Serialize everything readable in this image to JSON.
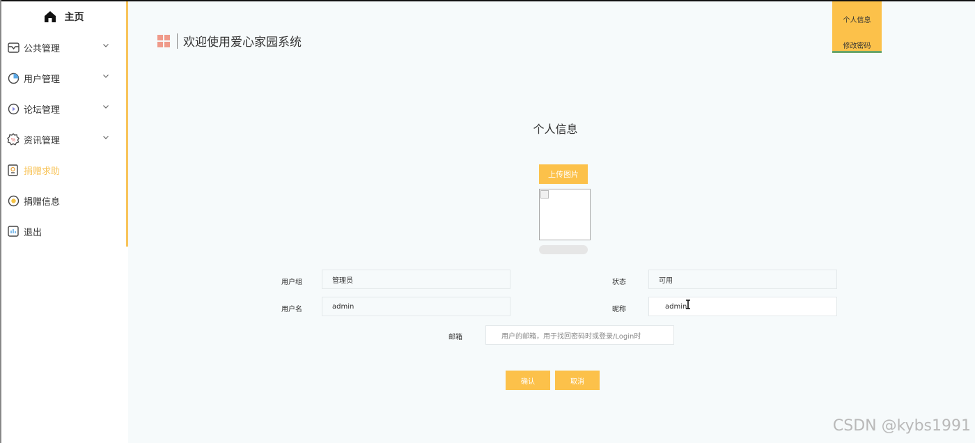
{
  "colors": {
    "accent": "#fcc14a",
    "active_text": "#f8c45a",
    "background": "#f6fafb"
  },
  "sidebar": {
    "home": {
      "label": "主页",
      "icon": "home-icon"
    },
    "items": [
      {
        "label": "公共管理",
        "icon": "mail-icon",
        "has_submenu": true
      },
      {
        "label": "用户管理",
        "icon": "pie-chart-icon",
        "has_submenu": true
      },
      {
        "label": "论坛管理",
        "icon": "play-circle-icon",
        "has_submenu": true
      },
      {
        "label": "资讯管理",
        "icon": "badge-icon",
        "has_submenu": true
      },
      {
        "label": "捐赠求助",
        "icon": "document-icon",
        "has_submenu": false,
        "active": true
      },
      {
        "label": "捐赠信息",
        "icon": "coin-icon",
        "has_submenu": false
      },
      {
        "label": "退出",
        "icon": "bar-chart-icon",
        "has_submenu": false
      }
    ]
  },
  "header": {
    "title": "欢迎使用爱心家园系统",
    "logo_icon": "grid-logo-icon",
    "user_menu": {
      "profile": "个人信息",
      "change_password": "修改密码"
    }
  },
  "main": {
    "title": "个人信息",
    "upload_label": "上传图片",
    "upload_progress": 0,
    "fields": {
      "group": {
        "label": "用户组",
        "value": "管理员"
      },
      "status": {
        "label": "状态",
        "value": "可用"
      },
      "username": {
        "label": "用户名",
        "value": "admin"
      },
      "nickname": {
        "label": "昵称",
        "value": "admin"
      },
      "email": {
        "label": "邮箱",
        "value": "",
        "placeholder": "用户的邮箱，用于找回密码时或登录/Login时"
      }
    },
    "confirm_label": "确认",
    "cancel_label": "取消"
  },
  "watermark": "CSDN @kybs1991"
}
